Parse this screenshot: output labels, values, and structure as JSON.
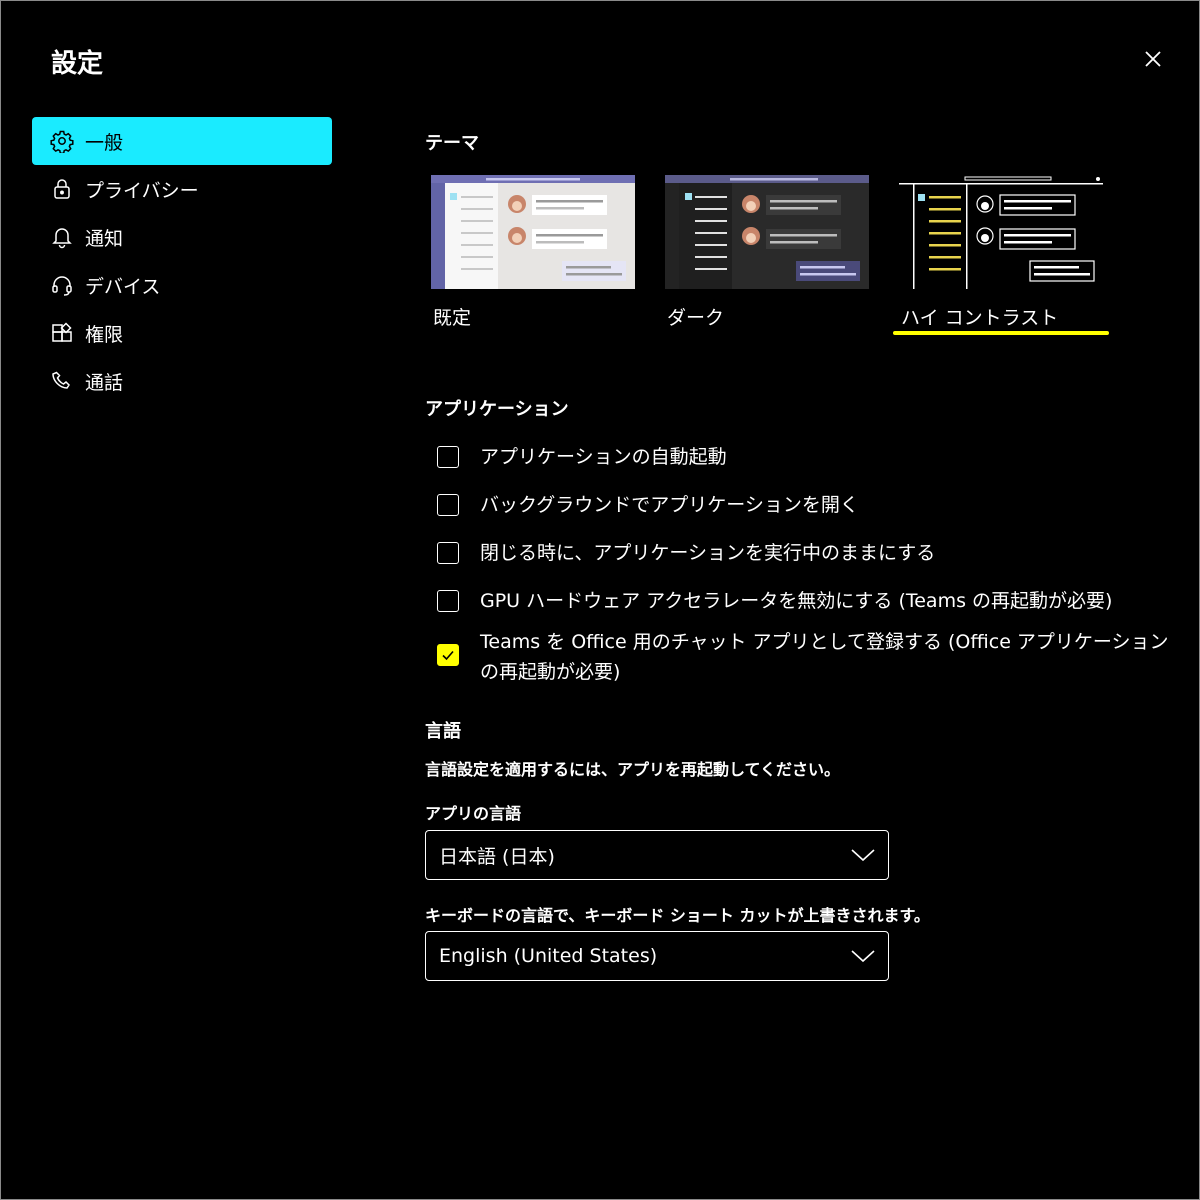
{
  "window": {
    "title": "設定"
  },
  "sidebar": {
    "items": [
      {
        "label": "一般",
        "icon": "gear-icon",
        "active": true
      },
      {
        "label": "プライバシー",
        "icon": "lock-icon"
      },
      {
        "label": "通知",
        "icon": "bell-icon"
      },
      {
        "label": "デバイス",
        "icon": "headset-icon"
      },
      {
        "label": "権限",
        "icon": "app-grid-icon"
      },
      {
        "label": "通話",
        "icon": "phone-icon"
      }
    ]
  },
  "theme": {
    "heading": "テーマ",
    "options": [
      {
        "label": "既定"
      },
      {
        "label": "ダーク"
      },
      {
        "label": "ハイ コントラスト",
        "selected": true
      }
    ]
  },
  "application": {
    "heading": "アプリケーション",
    "options": [
      {
        "label": "アプリケーションの自動起動",
        "checked": false
      },
      {
        "label": "バックグラウンドでアプリケーションを開く",
        "checked": false
      },
      {
        "label": "閉じる時に、アプリケーションを実行中のままにする",
        "checked": false
      },
      {
        "label": "GPU ハードウェア アクセラレータを無効にする (Teams の再起動が必要)",
        "checked": false
      },
      {
        "label": "Teams を Office 用のチャット アプリとして登録する (Office アプリケーションの再起動が必要)",
        "checked": true
      }
    ]
  },
  "language": {
    "heading": "言語",
    "restart_note": "言語設定を適用するには、アプリを再起動してください。",
    "app_language_label": "アプリの言語",
    "app_language_value": "日本語 (日本)",
    "keyboard_note": "キーボードの言語で、キーボード ショート カットが上書きされます。",
    "keyboard_language_value": "English (United States)"
  },
  "colors": {
    "accent": "#1aebff",
    "selection": "#ffff00",
    "background": "#000000"
  }
}
